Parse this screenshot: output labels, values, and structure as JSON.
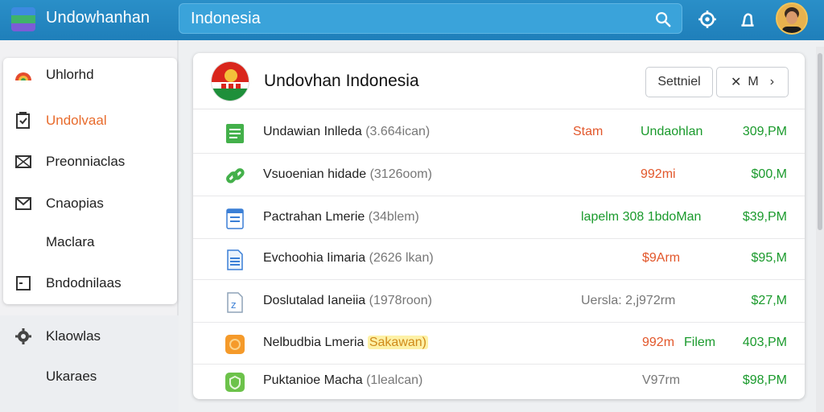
{
  "header": {
    "app_title": "Undowhanhan",
    "search_value": "Indonesia",
    "icons": [
      "search-icon",
      "settings-icon",
      "notification-icon",
      "avatar"
    ]
  },
  "sidebar": {
    "items": [
      {
        "label": "Uhlorhd",
        "icon": "app-logo-icon",
        "active": false
      },
      {
        "label": "Undolvaal",
        "icon": "document-icon",
        "active": true
      },
      {
        "label": "Preonniaclas",
        "icon": "mail-icon",
        "active": false
      },
      {
        "label": "Cnaopias",
        "icon": "envelope-icon",
        "active": false
      },
      {
        "label": "Maclara",
        "icon": "",
        "active": false
      },
      {
        "label": "Bndodnilaas",
        "icon": "square-icon",
        "active": false
      },
      {
        "label": "Klaowlas",
        "icon": "gear-icon",
        "active": false
      },
      {
        "label": "Ukaraes",
        "icon": "",
        "active": false
      }
    ]
  },
  "panel": {
    "title": "Undovhan Indonesia",
    "button_1": "Settniel",
    "button_2_icon": "✕",
    "button_2_label": "M",
    "button_2_chevron": "›",
    "rows": [
      {
        "name": "Undawian Inlleda",
        "meta": "(3.664ican)",
        "tag": "",
        "status": "Stam",
        "status2": "Undaohlan",
        "price": "309,PM",
        "icon": "spreadsheet-icon"
      },
      {
        "name": "Vsuoenian hidade",
        "meta": "(3126oom)",
        "tag": "",
        "status": "992mi",
        "status2": "",
        "price": "$00,M",
        "icon": "link-icon"
      },
      {
        "name": "Pactrahan Lmerie",
        "meta": "(34blem)",
        "tag": "",
        "status": "lapelm 308 1bdoMan",
        "status2": "",
        "price": "$39,PM",
        "icon": "doc-icon"
      },
      {
        "name": "Evchoohia Iimaria",
        "meta": "(2626 lkan)",
        "tag": "",
        "status": "$9Arm",
        "status2": "",
        "price": "$95,M",
        "icon": "notes-icon"
      },
      {
        "name": "Doslutalad Ianeiia",
        "meta": "(1978roon)",
        "tag": "",
        "status": "Uersla: 2,j972rm",
        "status2": "",
        "price": "$27,M",
        "icon": "file-z-icon"
      },
      {
        "name": "Nelbudbia Lmeria",
        "meta": "",
        "tag": "Sakawan)",
        "status": "992m",
        "status2": "Filem",
        "price": "403,PM",
        "icon": "orange-app-icon"
      },
      {
        "name": "Puktanioe Macha",
        "meta": "(1lealcan)",
        "tag": "",
        "status": "V97rm",
        "status2": "",
        "price": "$98,PM",
        "icon": "shield-icon"
      }
    ]
  },
  "colors": {
    "header": "#1f7fba",
    "accent_orange": "#e86b2c",
    "price_green": "#1a9a2c",
    "status_red": "#e2572b"
  }
}
